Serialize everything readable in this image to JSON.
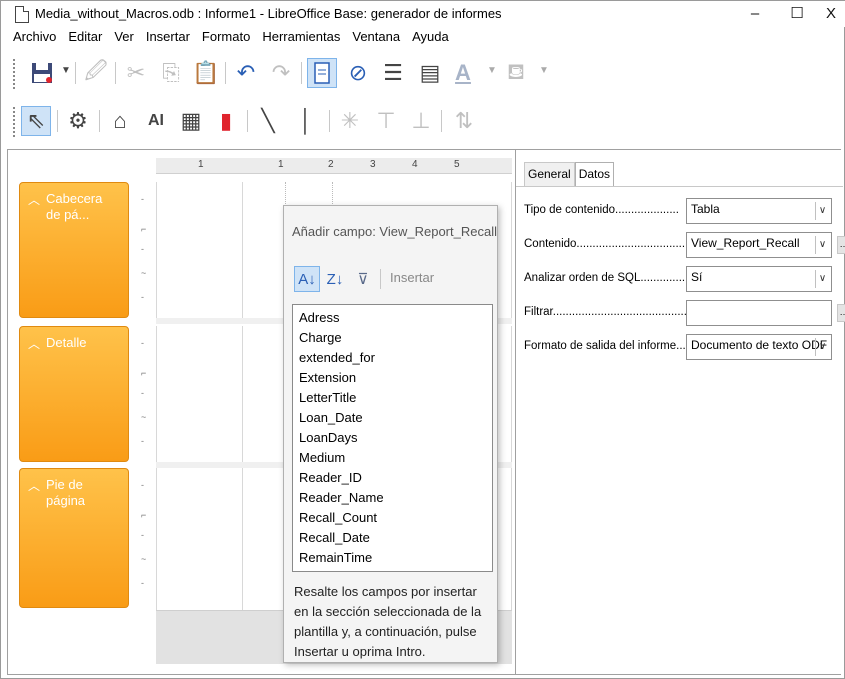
{
  "window": {
    "title": "Media_without_Macros.odb : Informe1 - LibreOffice Base: generador de informes",
    "minimize": "–",
    "maximize": "☐",
    "close": "X"
  },
  "menubar": [
    {
      "label": "Archivo"
    },
    {
      "label": "Editar"
    },
    {
      "label": "Ver"
    },
    {
      "label": "Insertar"
    },
    {
      "label": "Formato"
    },
    {
      "label": "Herramientas"
    },
    {
      "label": "Ventana"
    },
    {
      "label": "Ayuda"
    }
  ],
  "ruler": {
    "marks": [
      "1",
      "1",
      "2",
      "3",
      "4",
      "5"
    ]
  },
  "sections": [
    {
      "label": "Cabecera de pá..."
    },
    {
      "label": "Detalle"
    },
    {
      "label": "Pie de página"
    }
  ],
  "add_field_popup": {
    "title": "Añadir campo: View_Report_Recall",
    "insert_label": "Insertar",
    "fields": [
      "Adress",
      "Charge",
      "extended_for",
      "Extension",
      "LetterTitle",
      "Loan_Date",
      "LoanDays",
      "Medium",
      "Reader_ID",
      "Reader_Name",
      "Recall_Count",
      "Recall_Date",
      "RemainTime"
    ],
    "help_text": "Resalte los campos por insertar en la sección seleccionada de la plantilla y, a continuación, pulse Insertar u oprima Intro."
  },
  "properties": {
    "tabs": [
      "General",
      "Datos"
    ],
    "active_tab": "Datos",
    "rows": [
      {
        "label": "Tipo de contenido....................",
        "value": "Tabla"
      },
      {
        "label": "Contenido..................................",
        "value": "View_Report_Recall"
      },
      {
        "label": "Analizar orden de SQL..................",
        "value": "Sí"
      },
      {
        "label": "Filtrar.............................................",
        "value": ""
      },
      {
        "label": "Formato de salida del informe.....",
        "value": "Documento de texto ODF"
      }
    ]
  }
}
